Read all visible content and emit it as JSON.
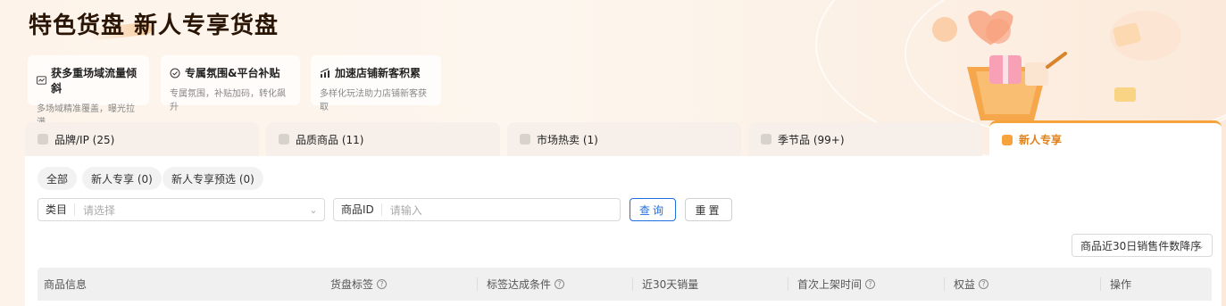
{
  "header": {
    "title": "特色货盘 新人专享货盘"
  },
  "benefits": [
    {
      "icon": "chart-window-icon",
      "title": "获多重场域流量倾斜",
      "subtitle": "多场域精准覆盖，曝光拉满"
    },
    {
      "icon": "check-circle-icon",
      "title": "专属氛围&平台补贴",
      "subtitle": "专属氛围，补贴加码，转化飙升"
    },
    {
      "icon": "bar-growth-icon",
      "title": "加速店铺新客积累",
      "subtitle": "多样化玩法助力店铺新客获取"
    }
  ],
  "tabs": [
    {
      "label": "品牌/IP (25)",
      "icon": "brand-icon",
      "active": false
    },
    {
      "label": "品质商品 (11)",
      "icon": "diamond-icon",
      "active": false
    },
    {
      "label": "市场热卖 (1)",
      "icon": "fire-icon",
      "active": false
    },
    {
      "label": "季节品 (99+)",
      "icon": "season-icon",
      "active": false
    },
    {
      "label": "新人专享",
      "icon": "gift-icon",
      "active": true
    }
  ],
  "filters": {
    "chips": [
      "全部",
      "新人专享 (0)",
      "新人专享预选 (0)"
    ],
    "category": {
      "label": "类目",
      "placeholder": "请选择"
    },
    "product_id": {
      "label": "商品ID",
      "placeholder": "请输入"
    },
    "query_label": "查询",
    "reset_label": "重置",
    "sort_label": "商品近30日销售件数降序"
  },
  "table": {
    "columns": [
      {
        "label": "商品信息",
        "help": false
      },
      {
        "label": "货盘标签",
        "help": true
      },
      {
        "label": "标签达成条件",
        "help": true
      },
      {
        "label": "近30天销量",
        "help": false
      },
      {
        "label": "首次上架时间",
        "help": true
      },
      {
        "label": "权益",
        "help": true
      },
      {
        "label": "操作",
        "help": false
      }
    ]
  },
  "colors": {
    "accent": "#f5a33a",
    "primary_button": "#1f6fe0",
    "active_tab_text": "#e0801a"
  }
}
